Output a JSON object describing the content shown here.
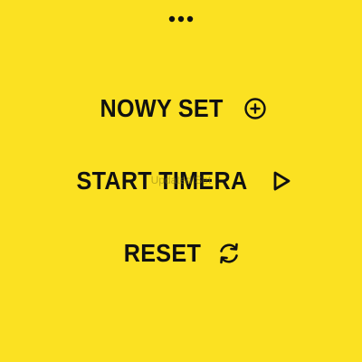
{
  "colors": {
    "background": "#FBE122",
    "foreground": "#111111",
    "toast": "#8a7d12"
  },
  "header": {
    "more_icon": "more-dots-icon"
  },
  "menu": {
    "items": [
      {
        "label": "NOWY SET",
        "icon": "plus-circle-icon"
      },
      {
        "label": "START TIMERA",
        "icon": "play-outline-icon"
      },
      {
        "label": "RESET",
        "icon": "refresh-icon"
      }
    ]
  },
  "toast": {
    "text": "Updated Set"
  }
}
